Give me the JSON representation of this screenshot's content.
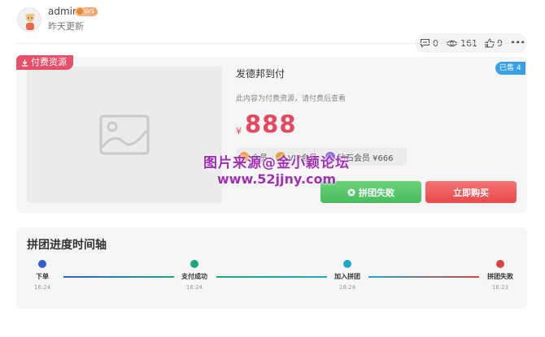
{
  "header": {
    "username": "admin",
    "level_badge": "LV1",
    "post_time": "昨天更新"
  },
  "stats": {
    "comments": "0",
    "views": "161",
    "likes": "9",
    "more": "•••"
  },
  "product": {
    "paid_tag": "付费资源",
    "sold_tag": "已售 4",
    "title": "发德邦到付",
    "description": "此内容为付费资源，请付费后查看",
    "currency": "¥",
    "price": "888",
    "members": [
      {
        "label": "会员",
        "color": "#f0a24a"
      },
      {
        "label": "VIP会员",
        "color": "#d9a640"
      },
      {
        "label": "钻石会员 ¥666",
        "color": "#8b6ee0"
      }
    ],
    "btn_fail": "拼团失败",
    "btn_buy": "立即购买"
  },
  "watermark": {
    "line1": "图片来源@金小颖论坛",
    "line2": "www.52jjny.com"
  },
  "timeline": {
    "title": "拼团进度时间轴",
    "nodes": [
      {
        "label": "下单",
        "time": "16:24",
        "color": "#2f5fce"
      },
      {
        "label": "支付成功",
        "time": "16:24",
        "color": "#1ba77b"
      },
      {
        "label": "加入拼团",
        "time": "16:24",
        "color": "#1fa9c9"
      },
      {
        "label": "拼团失败",
        "time": "16:23",
        "color": "#d9443d"
      }
    ]
  }
}
